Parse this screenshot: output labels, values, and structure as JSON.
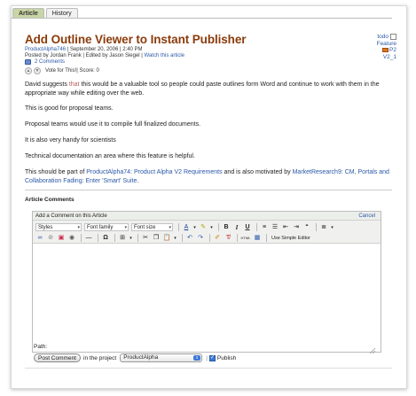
{
  "tabs": [
    {
      "label": "Article"
    },
    {
      "label": "History"
    }
  ],
  "article": {
    "title": "Add Outline Viewer to Instant Publisher",
    "meta_project": "ProductAlpha746",
    "meta_date": " | September 20, 2006 | 2:40 PM",
    "posted_by": "Posted by Jordan Frank | Edited by Jason Siegel | ",
    "watch": "Watch this article",
    "comments_count": "2 Comments",
    "vote": "Vote for This!",
    "score": " | Score: 0"
  },
  "side": {
    "status": "todo",
    "type": "Feature",
    "priority": "P2",
    "version": "V2_1"
  },
  "body": {
    "p1_a": "David suggests ",
    "p1_hl": "that",
    "p1_b": " this would be a valuable tool so people could paste outlines form Word and continue to work with them in the appropriate way while editing over the web.",
    "p2": "This is good for proposal teams.",
    "p3": "Proposal teams would use it to compile full finalized documents.",
    "p4": "It is also very handy for scientists",
    "p5": "Technical documentation an area where this feature is helpful.",
    "p6_a": "This should be part of ",
    "p6_link1": "ProductAlpha74: Product Alpha V2 Requirements",
    "p6_b": " and is also motivated by ",
    "p6_link2": "MarketResearch9: CM, Portals and Collaboration Fading: Enter 'Smart' Suite",
    "p6_c": "."
  },
  "comments": {
    "section_title": "Article Comments",
    "add_label": "Add a Comment on this Article",
    "cancel": "Cancel",
    "toolbar": {
      "styles": "Styles",
      "font_family": "Font family",
      "font_size": "Font size",
      "use_simple_editor": "Use Simple Editor"
    },
    "path_label": "Path:",
    "post_button": "Post Comment",
    "in_project": "in the project",
    "project_value": "ProductAlpha",
    "publish_label": "Publish"
  }
}
